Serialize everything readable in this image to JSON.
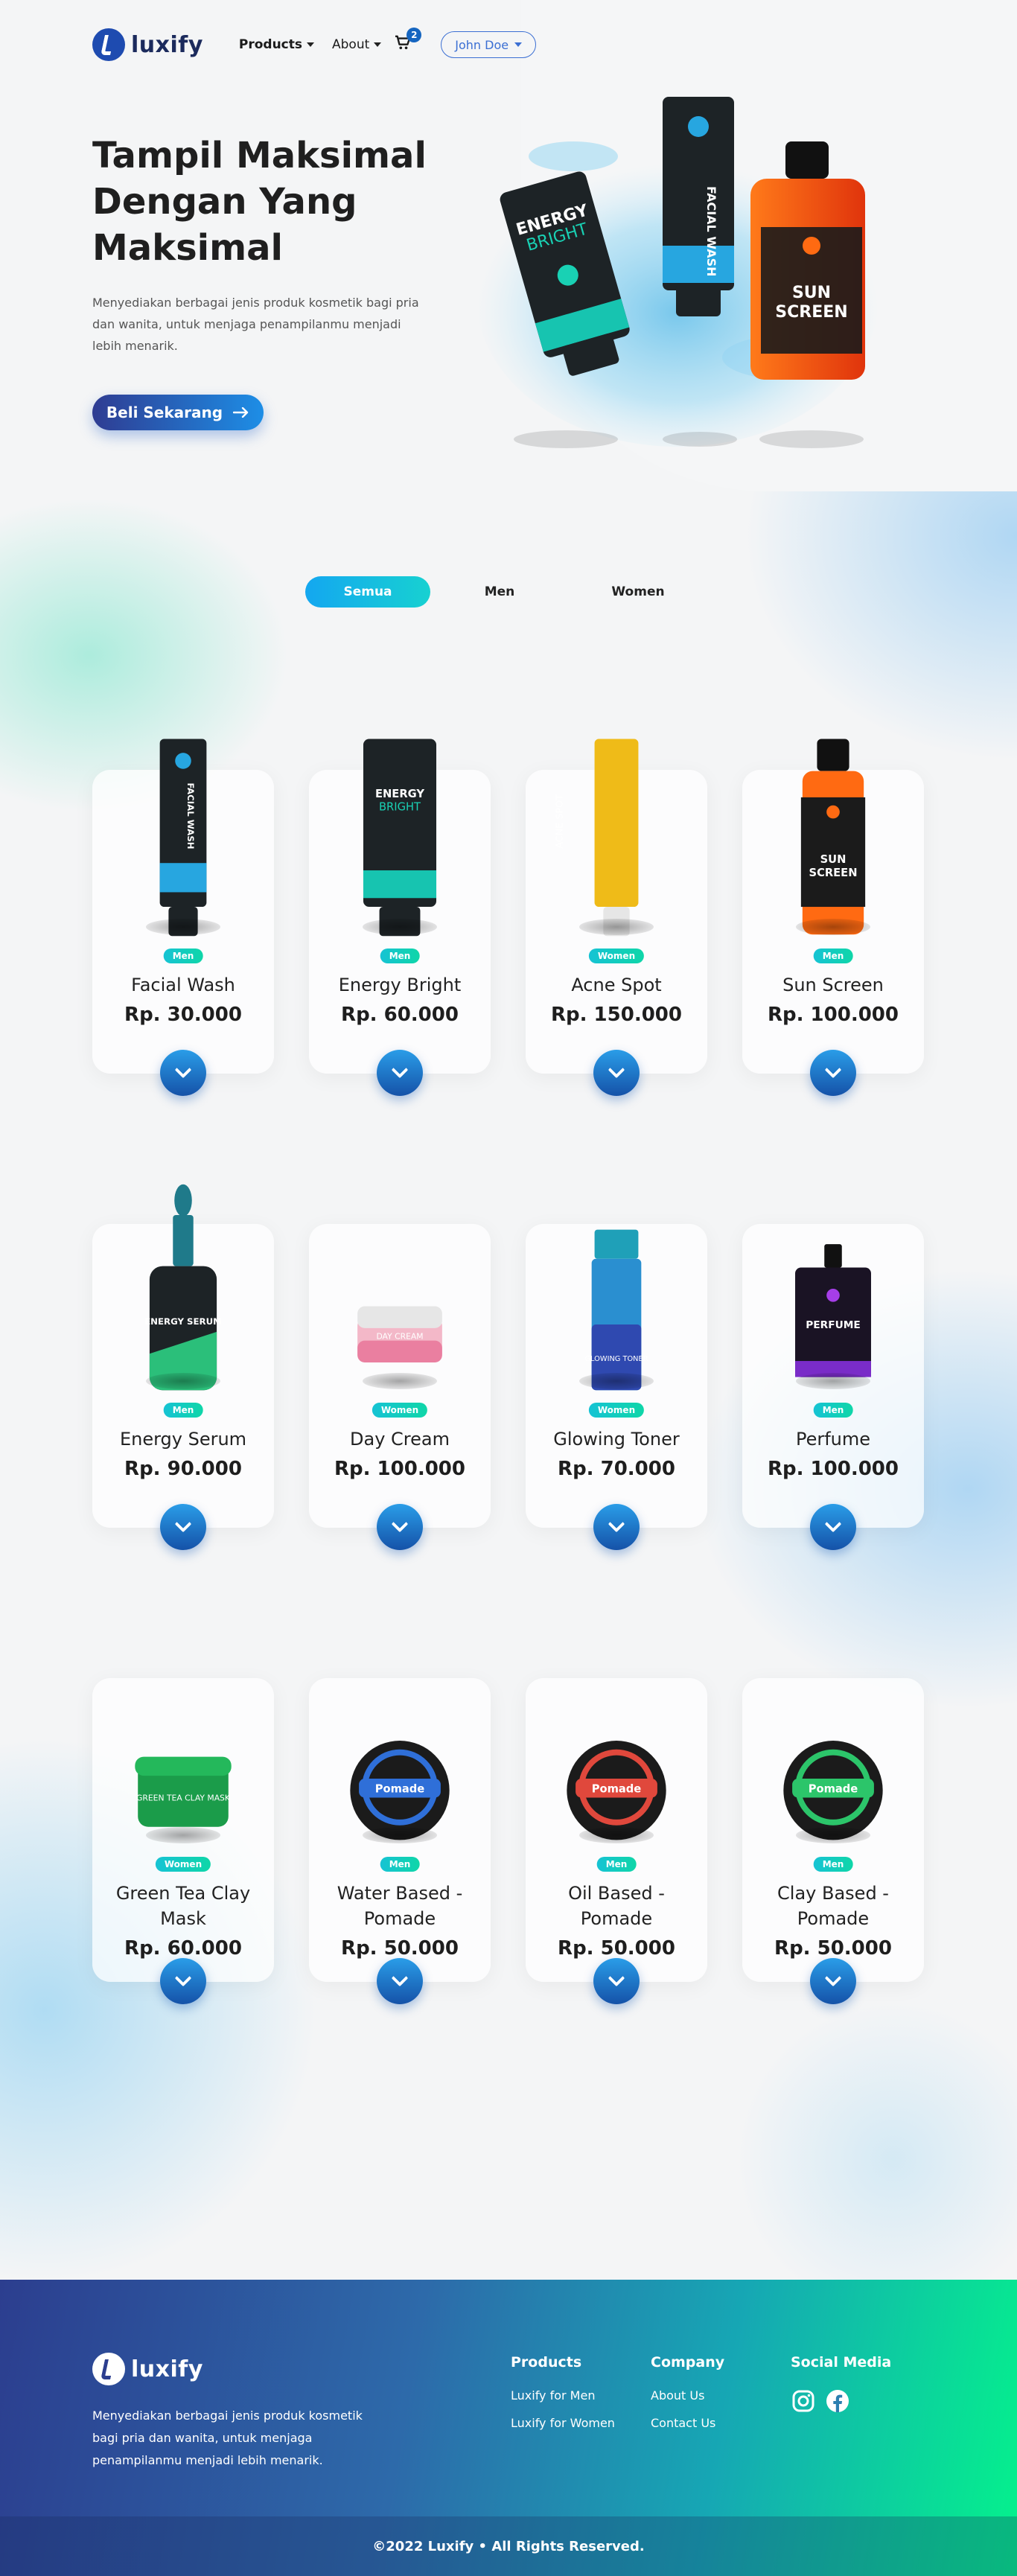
{
  "brand": {
    "name": "luxify"
  },
  "nav": {
    "products_label": "Products",
    "about_label": "About",
    "cart_count": "2",
    "user_label": "John Doe"
  },
  "hero": {
    "title": "Tampil Maksimal Dengan Yang Maksimal",
    "description": "Menyediakan berbagai jenis produk kosmetik bagi pria dan wanita, untuk menjaga penampilanmu menjadi lebih menarik.",
    "cta_label": "Beli Sekarang",
    "cta_icon": "arrow-right-icon"
  },
  "filters": {
    "tabs": [
      {
        "label": "Semua",
        "active": true
      },
      {
        "label": "Men",
        "active": false
      },
      {
        "label": "Women",
        "active": false
      }
    ]
  },
  "products": [
    {
      "name": "Facial Wash",
      "category": "Men",
      "price": "Rp. 30.000",
      "icon": "facial-wash-product-image"
    },
    {
      "name": "Energy Bright",
      "category": "Men",
      "price": "Rp. 60.000",
      "icon": "energy-bright-product-image"
    },
    {
      "name": "Acne Spot",
      "category": "Women",
      "price": "Rp. 150.000",
      "icon": "acne-spot-product-image"
    },
    {
      "name": "Sun Screen",
      "category": "Men",
      "price": "Rp. 100.000",
      "icon": "sun-screen-product-image"
    },
    {
      "name": "Energy Serum",
      "category": "Men",
      "price": "Rp. 90.000",
      "icon": "energy-serum-product-image"
    },
    {
      "name": "Day Cream",
      "category": "Women",
      "price": "Rp. 100.000",
      "icon": "day-cream-product-image"
    },
    {
      "name": "Glowing Toner",
      "category": "Women",
      "price": "Rp. 70.000",
      "icon": "glowing-toner-product-image"
    },
    {
      "name": "Perfume",
      "category": "Men",
      "price": "Rp. 100.000",
      "icon": "perfume-product-image"
    },
    {
      "name": "Green Tea Clay Mask",
      "category": "Women",
      "price": "Rp. 60.000",
      "icon": "clay-mask-product-image"
    },
    {
      "name": "Water Based - Pomade",
      "category": "Men",
      "price": "Rp. 50.000",
      "icon": "pomade-blue-product-image"
    },
    {
      "name": "Oil Based - Pomade",
      "category": "Men",
      "price": "Rp. 50.000",
      "icon": "pomade-red-product-image"
    },
    {
      "name": "Clay Based - Pomade",
      "category": "Men",
      "price": "Rp. 50.000",
      "icon": "pomade-green-product-image"
    }
  ],
  "footer": {
    "description": "Menyediakan berbagai jenis produk kosmetik bagi pria dan wanita, untuk menjaga penampilanmu menjadi lebih menarik.",
    "products_heading": "Products",
    "products_links": [
      "Luxify for Men",
      "Luxify for Women"
    ],
    "company_heading": "Company",
    "company_links": [
      "About Us",
      "Contact Us"
    ],
    "social_heading": "Social Media",
    "social_icons": [
      "instagram-icon",
      "facebook-icon"
    ],
    "copyright": "©2022 Luxify • All Rights Reserved."
  },
  "colors": {
    "primary": "#1e4bb0",
    "accent_teal": "#16c3d4",
    "footer_start": "#2c3e8f",
    "footer_end": "#04f28c"
  }
}
